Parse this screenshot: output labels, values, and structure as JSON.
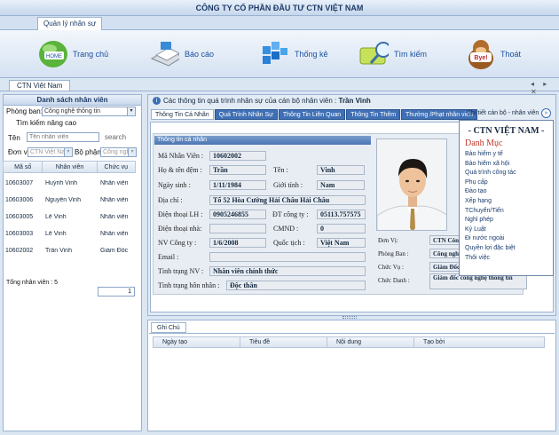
{
  "app": {
    "title": "CÔNG TY CỔ PHẦN ĐẦU TƯ CTN VIỆT NAM",
    "ribbon_tab": "Quản lý nhân sự",
    "doc_tab": "CTN Việt Nam"
  },
  "toolbar": {
    "home_icon_text": "HOME",
    "home": "Trang chủ",
    "report": "Báo cáo",
    "stats": "Thống kê",
    "search": "Tìm kiếm",
    "exit": "Thoát",
    "exit_icon_text": "Bye!"
  },
  "window_controls": "◂ ▸ ✕",
  "left": {
    "header": "Danh sách nhân viên",
    "dept_label": "Phòng ban:",
    "dept_value": "Công nghệ thông tin",
    "advanced": "Tìm kiếm nâng cao",
    "name_label": "Tên",
    "name_placeholder": "Tên nhân viên",
    "search_btn": "search",
    "unit_label": "Đơn vị",
    "unit_value": "CTN Việt Nam",
    "dept2_label": "Bộ phận",
    "dept2_value": "Công nghệ",
    "columns": [
      "Mã số",
      "Nhân viên",
      "Chức vụ"
    ],
    "rows": [
      {
        "id": "10603007",
        "name": "Huỳnh Vinh",
        "pos": "Nhân viên"
      },
      {
        "id": "10603006",
        "name": "Nguyễn Vinh",
        "pos": "Nhân viên"
      },
      {
        "id": "10603005",
        "name": "Lê Vinh",
        "pos": "Nhân viên"
      },
      {
        "id": "10603003",
        "name": "Lê Vinh",
        "pos": "Nhân viên"
      },
      {
        "id": "10602002",
        "name": "Trần Vinh",
        "pos": "Giám Đốc"
      }
    ],
    "total_label": "Tổng nhân viên : 5",
    "page": "1"
  },
  "right": {
    "info_prefix": "Các thông tin quá trình nhân sự của cán bộ nhân viên :",
    "info_name": "Trần Vinh",
    "tabs": [
      "Thông Tin Cá Nhân",
      "Quá Trình Nhân Sự",
      "Thông Tin Liên Quan",
      "Thông Tin Thêm",
      "Thưởng /Phạt nhân viên"
    ],
    "detail_label": "Chi tiết cán bộ - nhân viên",
    "section": "Thông tin cá nhân",
    "fields": {
      "emp_id_l": "Mã Nhân Viên :",
      "emp_id": "10602002",
      "surname_l": "Họ & tên đệm :",
      "surname": "Trần",
      "name_l": "Tên :",
      "name": "Vinh",
      "dob_l": "Ngày sinh :",
      "dob": "1/11/1984",
      "gender_l": "Giới tính :",
      "gender": "Nam",
      "addr_l": "Địa chỉ :",
      "addr": "Tổ 52 Hòa Cường Hải Châu Hải Châu",
      "phone_l": "Điện thoại LH :",
      "phone": "0905246855",
      "cphone_l": "ĐT công ty :",
      "cphone": "05113.757575",
      "home_l": "Điện thoại nhà:",
      "home": "",
      "cmnd_l": "CMND :",
      "cmnd": "0",
      "start_l": "NV Công ty :",
      "start": "1/6/2008",
      "nation_l": "Quốc tịch :",
      "nation": "Việt Nam",
      "email_l": "Email :",
      "email": "",
      "status_l": "Tình trạng NV :",
      "status": "Nhân viên chính thức",
      "marital_l": "Tình trạng hôn nhân :",
      "marital": "Độc thân",
      "unit_l": "Đơn Vị:",
      "unit": "CTN Công",
      "dept_l": "Phòng Ban :",
      "dept": "Công nghệ",
      "pos_l": "Chức Vụ :",
      "pos": "Giám Đốc",
      "title_l": "Chức Danh :",
      "title": "Giám đốc công nghệ thông tin"
    }
  },
  "popup": {
    "title": "- CTN VIỆT NAM -",
    "subtitle": "Danh Mục",
    "items": [
      "Bảo hiểm y tế",
      "Bảo hiểm xã hội",
      "Quá trình công tác",
      "Phụ cấp",
      "Đào tạo",
      "Xếp hạng",
      "TChuyển/Tiến",
      "Nghỉ phép",
      "Kỷ Luật",
      "Đi nước ngoài",
      "Quyền lợi đặc biệt",
      "Thôi việc"
    ]
  },
  "notes": {
    "tab": "Ghi Chú",
    "columns": [
      "Ngày tạo",
      "Tiêu đề",
      "Nội dung",
      "Tạo bởi"
    ]
  }
}
